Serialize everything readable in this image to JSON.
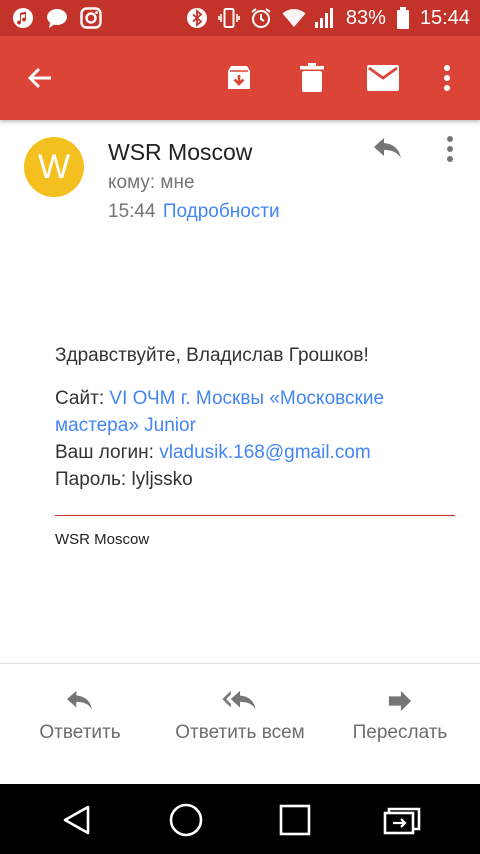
{
  "status_bar": {
    "battery": "83%",
    "time": "15:44",
    "icons": [
      "music-icon",
      "chat-icon",
      "instagram-icon",
      "bluetooth-icon",
      "vibrate-icon",
      "alarm-icon",
      "wifi-icon",
      "signal-icon",
      "battery-icon"
    ]
  },
  "app_bar": {
    "color": "#db4437",
    "icons": [
      "back-arrow-icon",
      "archive-icon",
      "delete-icon",
      "mail-icon",
      "more-vert-icon"
    ]
  },
  "message": {
    "avatar_letter": "W",
    "avatar_color": "#f4c020",
    "sender": "WSR Moscow",
    "recipient": "кому: мне",
    "time": "15:44",
    "details_link": "Подробности"
  },
  "body": {
    "greeting": "Здравствуйте, Владислав Грошков!",
    "site_label": "Сайт:",
    "site_link": "VI ОЧМ г. Москвы «Московские мастера» Junior",
    "login_label": "Ваш логин:",
    "login_value": "vladusik.168@gmail.com",
    "password_label": "Пароль:",
    "password_value": "lyljssko",
    "signature": "WSR Moscow"
  },
  "actions": {
    "reply": "Ответить",
    "reply_all": "Ответить всем",
    "forward": "Переслать"
  },
  "nav_bar": {
    "icons": [
      "back-triangle-icon",
      "home-circle-icon",
      "recents-square-icon",
      "screen-mirror-icon"
    ]
  }
}
